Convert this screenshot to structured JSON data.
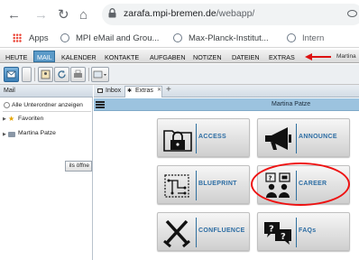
{
  "browser": {
    "url_host": "zarafa.mpi-bremen.de",
    "url_path": "/webapp/",
    "bookmarks": [
      {
        "label": "Apps"
      },
      {
        "label": "MPI eMail and Grou..."
      },
      {
        "label": "Max-Planck-Institut..."
      },
      {
        "label": "Intern"
      }
    ]
  },
  "main_menu": {
    "items": [
      "HEUTE",
      "MAIL",
      "KALENDER",
      "KONTAKTE",
      "AUFGABEN",
      "NOTIZEN",
      "DATEIEN",
      "EXTRAS"
    ],
    "active": "MAIL",
    "user_fragment": "Martina"
  },
  "left_panel": {
    "title": "Mail",
    "show_all_folders": "Alle Unterordner anzeigen",
    "favorites": "Favoriten",
    "store": "Martina Patze",
    "open_button": "ils öffne"
  },
  "tabs": {
    "inbox": "Inbox",
    "extras": "Extras"
  },
  "content": {
    "user_name": "Martina Patze",
    "tiles": [
      {
        "label": "ACCESS",
        "icon": "padlock-folder-icon"
      },
      {
        "label": "ANNOUNCE",
        "icon": "megaphone-icon"
      },
      {
        "label": "BLUEPRINT",
        "icon": "circuit-blueprint-icon"
      },
      {
        "label": "CAREER",
        "icon": "career-people-icon"
      },
      {
        "label": "CONFLUENCE",
        "icon": "crossed-swords-icon"
      },
      {
        "label": "FAQs",
        "icon": "faq-speech-bubbles-icon"
      }
    ]
  },
  "colors": {
    "accent": "#2b6ca3",
    "header_blue": "#9cc3df",
    "mail_active": "#5b9ac8",
    "annotation_red": "#dd1111"
  }
}
